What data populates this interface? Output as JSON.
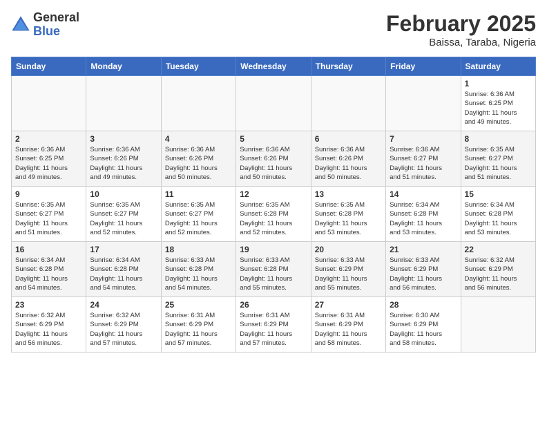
{
  "header": {
    "logo_general": "General",
    "logo_blue": "Blue",
    "month_title": "February 2025",
    "location": "Baissa, Taraba, Nigeria"
  },
  "weekdays": [
    "Sunday",
    "Monday",
    "Tuesday",
    "Wednesday",
    "Thursday",
    "Friday",
    "Saturday"
  ],
  "weeks": [
    [
      {
        "day": "",
        "info": ""
      },
      {
        "day": "",
        "info": ""
      },
      {
        "day": "",
        "info": ""
      },
      {
        "day": "",
        "info": ""
      },
      {
        "day": "",
        "info": ""
      },
      {
        "day": "",
        "info": ""
      },
      {
        "day": "1",
        "info": "Sunrise: 6:36 AM\nSunset: 6:25 PM\nDaylight: 11 hours\nand 49 minutes."
      }
    ],
    [
      {
        "day": "2",
        "info": "Sunrise: 6:36 AM\nSunset: 6:25 PM\nDaylight: 11 hours\nand 49 minutes."
      },
      {
        "day": "3",
        "info": "Sunrise: 6:36 AM\nSunset: 6:26 PM\nDaylight: 11 hours\nand 49 minutes."
      },
      {
        "day": "4",
        "info": "Sunrise: 6:36 AM\nSunset: 6:26 PM\nDaylight: 11 hours\nand 50 minutes."
      },
      {
        "day": "5",
        "info": "Sunrise: 6:36 AM\nSunset: 6:26 PM\nDaylight: 11 hours\nand 50 minutes."
      },
      {
        "day": "6",
        "info": "Sunrise: 6:36 AM\nSunset: 6:26 PM\nDaylight: 11 hours\nand 50 minutes."
      },
      {
        "day": "7",
        "info": "Sunrise: 6:36 AM\nSunset: 6:27 PM\nDaylight: 11 hours\nand 51 minutes."
      },
      {
        "day": "8",
        "info": "Sunrise: 6:35 AM\nSunset: 6:27 PM\nDaylight: 11 hours\nand 51 minutes."
      }
    ],
    [
      {
        "day": "9",
        "info": "Sunrise: 6:35 AM\nSunset: 6:27 PM\nDaylight: 11 hours\nand 51 minutes."
      },
      {
        "day": "10",
        "info": "Sunrise: 6:35 AM\nSunset: 6:27 PM\nDaylight: 11 hours\nand 52 minutes."
      },
      {
        "day": "11",
        "info": "Sunrise: 6:35 AM\nSunset: 6:27 PM\nDaylight: 11 hours\nand 52 minutes."
      },
      {
        "day": "12",
        "info": "Sunrise: 6:35 AM\nSunset: 6:28 PM\nDaylight: 11 hours\nand 52 minutes."
      },
      {
        "day": "13",
        "info": "Sunrise: 6:35 AM\nSunset: 6:28 PM\nDaylight: 11 hours\nand 53 minutes."
      },
      {
        "day": "14",
        "info": "Sunrise: 6:34 AM\nSunset: 6:28 PM\nDaylight: 11 hours\nand 53 minutes."
      },
      {
        "day": "15",
        "info": "Sunrise: 6:34 AM\nSunset: 6:28 PM\nDaylight: 11 hours\nand 53 minutes."
      }
    ],
    [
      {
        "day": "16",
        "info": "Sunrise: 6:34 AM\nSunset: 6:28 PM\nDaylight: 11 hours\nand 54 minutes."
      },
      {
        "day": "17",
        "info": "Sunrise: 6:34 AM\nSunset: 6:28 PM\nDaylight: 11 hours\nand 54 minutes."
      },
      {
        "day": "18",
        "info": "Sunrise: 6:33 AM\nSunset: 6:28 PM\nDaylight: 11 hours\nand 54 minutes."
      },
      {
        "day": "19",
        "info": "Sunrise: 6:33 AM\nSunset: 6:28 PM\nDaylight: 11 hours\nand 55 minutes."
      },
      {
        "day": "20",
        "info": "Sunrise: 6:33 AM\nSunset: 6:29 PM\nDaylight: 11 hours\nand 55 minutes."
      },
      {
        "day": "21",
        "info": "Sunrise: 6:33 AM\nSunset: 6:29 PM\nDaylight: 11 hours\nand 56 minutes."
      },
      {
        "day": "22",
        "info": "Sunrise: 6:32 AM\nSunset: 6:29 PM\nDaylight: 11 hours\nand 56 minutes."
      }
    ],
    [
      {
        "day": "23",
        "info": "Sunrise: 6:32 AM\nSunset: 6:29 PM\nDaylight: 11 hours\nand 56 minutes."
      },
      {
        "day": "24",
        "info": "Sunrise: 6:32 AM\nSunset: 6:29 PM\nDaylight: 11 hours\nand 57 minutes."
      },
      {
        "day": "25",
        "info": "Sunrise: 6:31 AM\nSunset: 6:29 PM\nDaylight: 11 hours\nand 57 minutes."
      },
      {
        "day": "26",
        "info": "Sunrise: 6:31 AM\nSunset: 6:29 PM\nDaylight: 11 hours\nand 57 minutes."
      },
      {
        "day": "27",
        "info": "Sunrise: 6:31 AM\nSunset: 6:29 PM\nDaylight: 11 hours\nand 58 minutes."
      },
      {
        "day": "28",
        "info": "Sunrise: 6:30 AM\nSunset: 6:29 PM\nDaylight: 11 hours\nand 58 minutes."
      },
      {
        "day": "",
        "info": ""
      }
    ]
  ]
}
